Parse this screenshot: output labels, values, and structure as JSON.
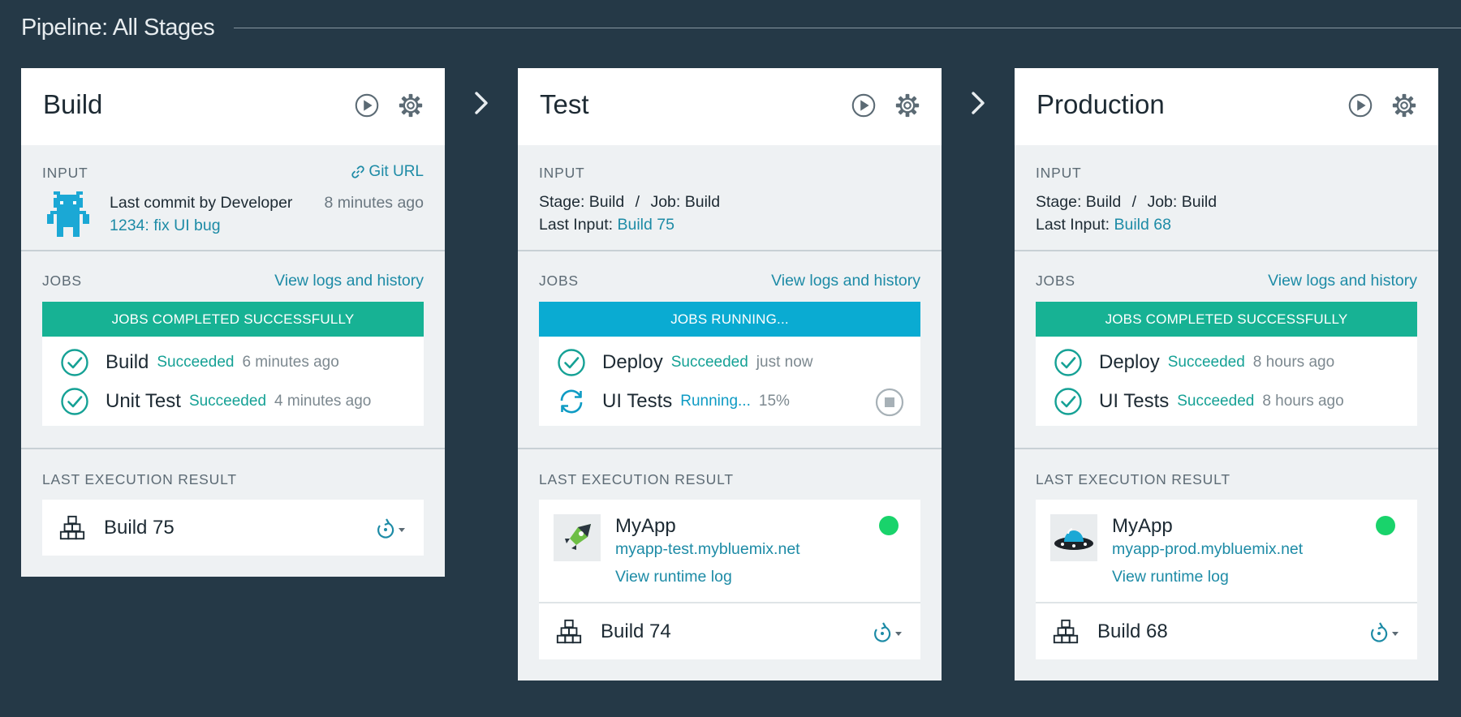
{
  "page": {
    "title": "Pipeline: All Stages"
  },
  "colors": {
    "background": "#253947",
    "success_banner": "#17b294",
    "running_banner": "#0aabd2",
    "link": "#1d8ba6",
    "success_text": "#15a195",
    "status_dot": "#19d36b"
  },
  "stages": [
    {
      "name": "Build",
      "input": {
        "label": "INPUT",
        "git_url": "Git URL",
        "commit_prefix": "Last commit by ",
        "commit_author": "Developer",
        "commit_time": "8 minutes ago",
        "commit_link": "1234: fix UI bug"
      },
      "jobs": {
        "label": "JOBS",
        "view_logs": "View logs and history",
        "banner": "JOBS COMPLETED SUCCESSFULLY",
        "items": [
          {
            "name": "Build",
            "status": "Succeeded",
            "time": "6 minutes ago",
            "icon": "check-circle-icon"
          },
          {
            "name": "Unit Test",
            "status": "Succeeded",
            "time": "4 minutes ago",
            "icon": "check-circle-icon"
          }
        ]
      },
      "last_execution": {
        "label": "LAST EXECUTION RESULT",
        "build": "Build 75"
      }
    },
    {
      "name": "Test",
      "input": {
        "label": "INPUT",
        "stage_prefix": "Stage: ",
        "stage_value": "Build",
        "separator": "/",
        "job_prefix": "Job: ",
        "job_value": "Build",
        "last_input_prefix": "Last Input: ",
        "last_input_link": "Build 75"
      },
      "jobs": {
        "label": "JOBS",
        "view_logs": "View logs and history",
        "banner": "JOBS RUNNING...",
        "items": [
          {
            "name": "Deploy",
            "status": "Succeeded",
            "time": "just now",
            "icon": "check-circle-icon"
          },
          {
            "name": "UI Tests",
            "status": "Running...",
            "time": "15%",
            "icon": "sync-icon"
          }
        ]
      },
      "last_execution": {
        "label": "LAST EXECUTION RESULT",
        "app_name": "MyApp",
        "app_url": "myapp-test.mybluemix.net",
        "runtime_log": "View runtime log",
        "build": "Build 74"
      }
    },
    {
      "name": "Production",
      "input": {
        "label": "INPUT",
        "stage_prefix": "Stage: ",
        "stage_value": "Build",
        "separator": "/",
        "job_prefix": "Job: ",
        "job_value": "Build",
        "last_input_prefix": "Last Input: ",
        "last_input_link": "Build 68"
      },
      "jobs": {
        "label": "JOBS",
        "view_logs": "View logs and history",
        "banner": "JOBS COMPLETED SUCCESSFULLY",
        "items": [
          {
            "name": "Deploy",
            "status": "Succeeded",
            "time": "8 hours ago",
            "icon": "check-circle-icon"
          },
          {
            "name": "UI Tests",
            "status": "Succeeded",
            "time": "8 hours ago",
            "icon": "check-circle-icon"
          }
        ]
      },
      "last_execution": {
        "label": "LAST EXECUTION RESULT",
        "app_name": "MyApp",
        "app_url": "myapp-prod.mybluemix.net",
        "runtime_log": "View runtime log",
        "build": "Build 68"
      }
    }
  ]
}
